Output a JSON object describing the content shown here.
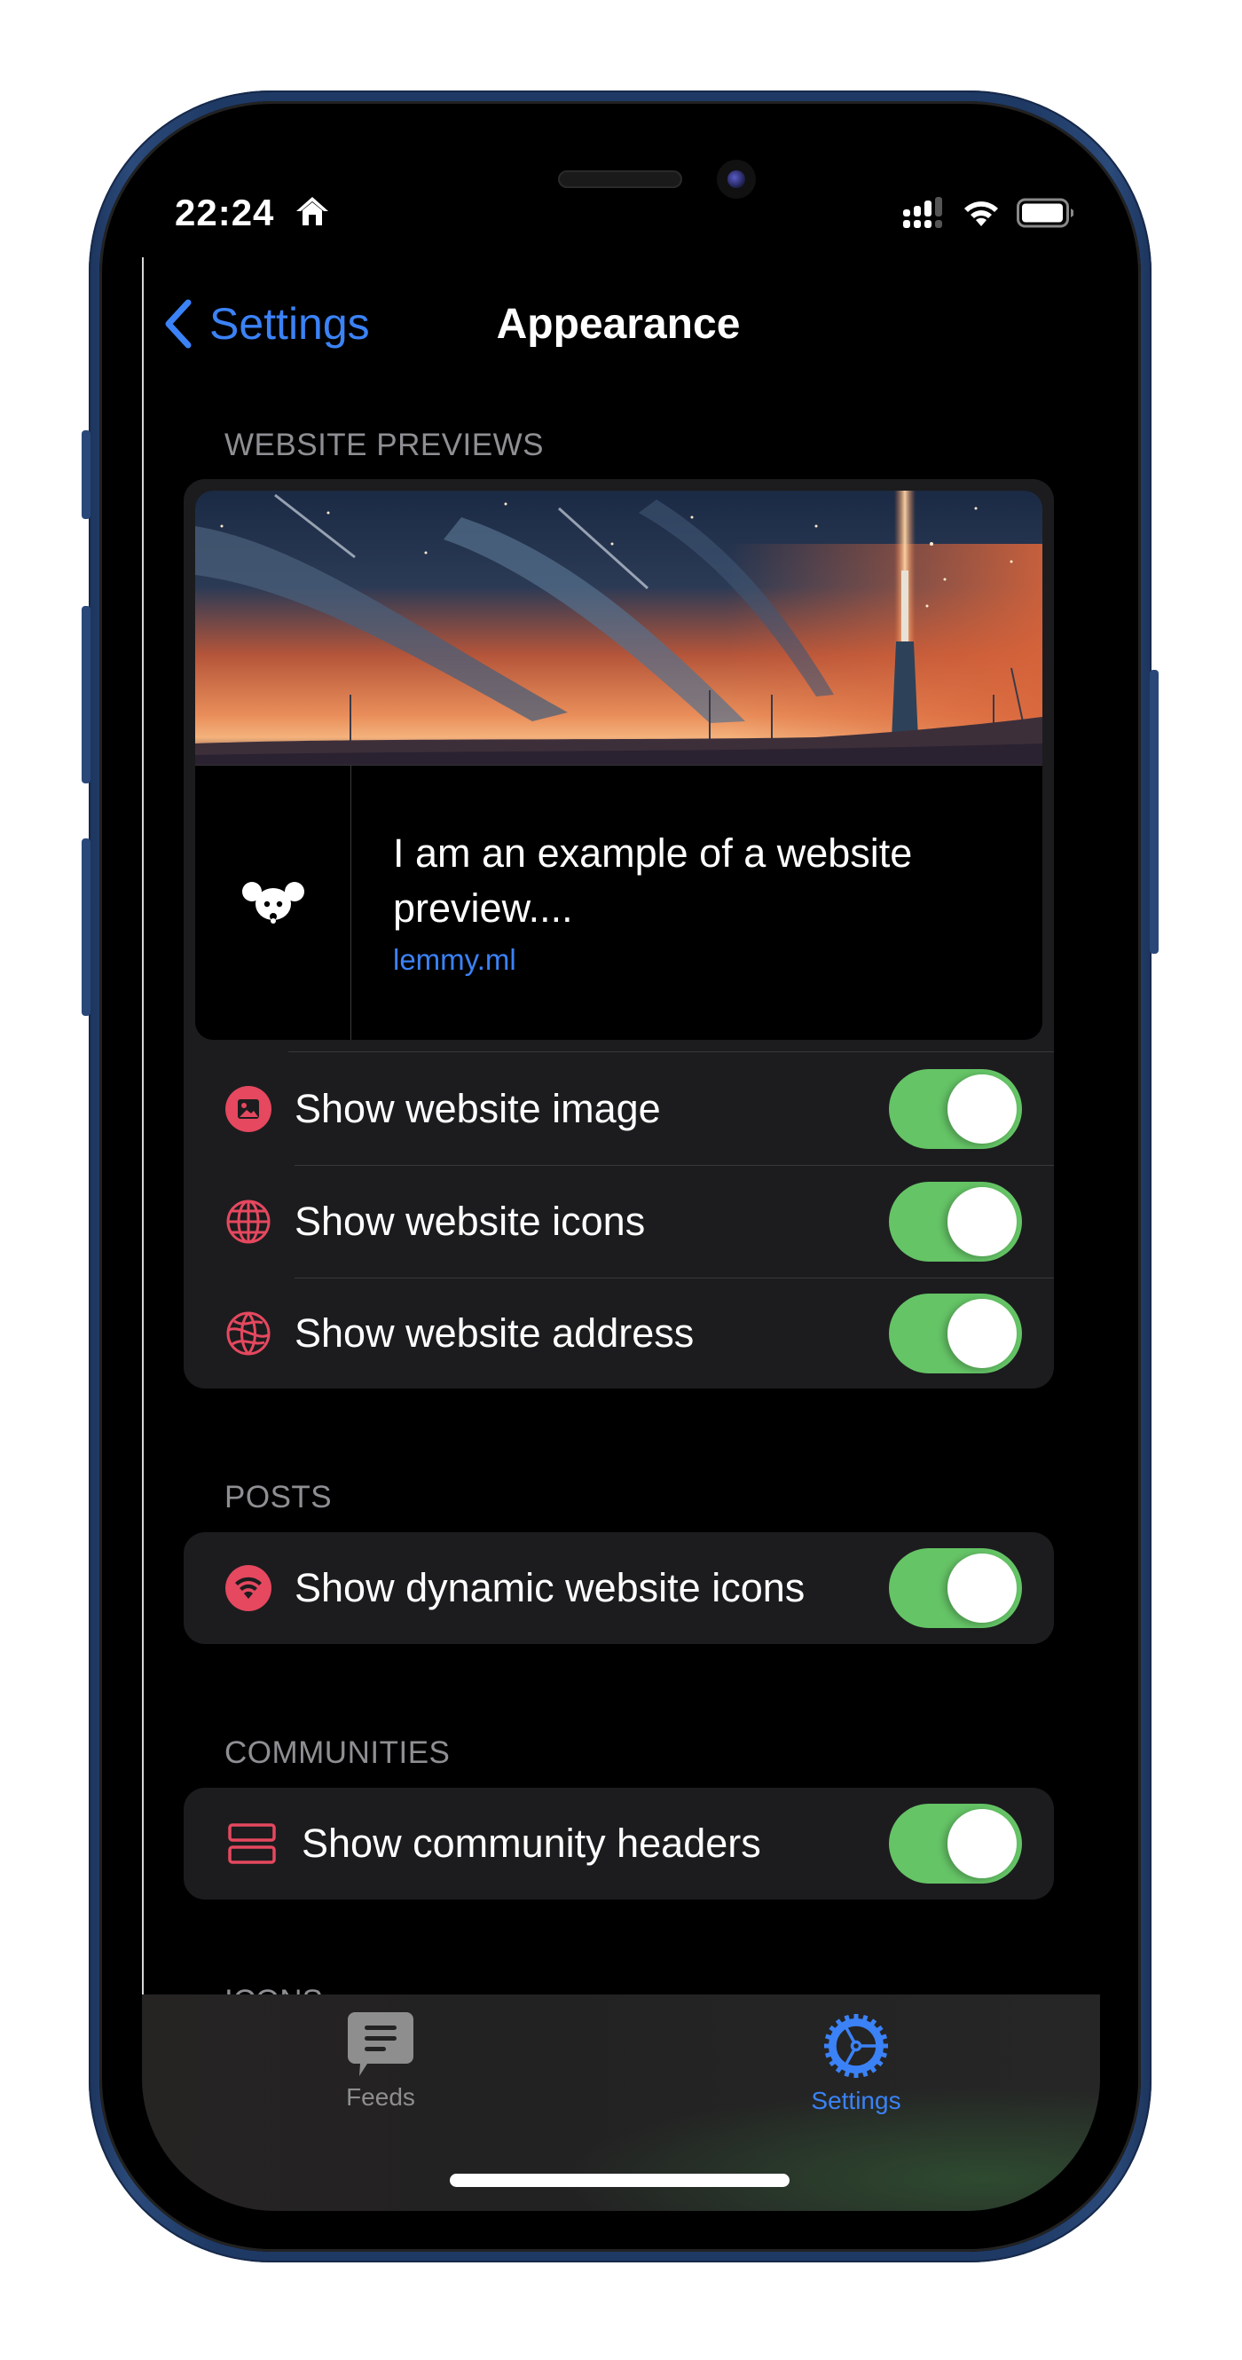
{
  "status_bar": {
    "time": "22:24",
    "focus_icon": "home-icon",
    "signal_bars": 3,
    "signal_total": 4,
    "battery_level": 0.9
  },
  "nav": {
    "back_label": "Settings",
    "title": "Appearance"
  },
  "sections": {
    "website_previews": {
      "header": "WEBSITE PREVIEWS",
      "preview": {
        "title": "I am an example of a website preview....",
        "url": "lemmy.ml",
        "image_description": "rocket-launch-illustration",
        "icon": "lemmy-icon"
      },
      "rows": [
        {
          "label": "Show website image",
          "icon": "photo-icon",
          "on": true
        },
        {
          "label": "Show website icons",
          "icon": "globe-icon",
          "on": true
        },
        {
          "label": "Show website address",
          "icon": "globe-address-icon",
          "on": true
        }
      ]
    },
    "posts": {
      "header": "POSTS",
      "rows": [
        {
          "label": "Show dynamic website icons",
          "icon": "wifi-circle-icon",
          "on": true
        }
      ]
    },
    "communities": {
      "header": "COMMUNITIES",
      "rows": [
        {
          "label": "Show community headers",
          "icon": "rectangles-icon",
          "on": true
        }
      ]
    },
    "icons": {
      "header": "ICONS"
    }
  },
  "tab_bar": {
    "tabs": [
      {
        "label": "Feeds",
        "icon": "chat-bubble-icon",
        "active": false
      },
      {
        "label": "Settings",
        "icon": "gear-icon",
        "active": true
      }
    ]
  },
  "colors": {
    "accent": "#3b82f6",
    "icon_tint": "#e5485f",
    "toggle_on": "#65c466",
    "card_bg": "#1c1c1e",
    "section_header": "#8e8e93",
    "tab_inactive": "#8e8e8e",
    "phone_frame": "#1e3964"
  }
}
